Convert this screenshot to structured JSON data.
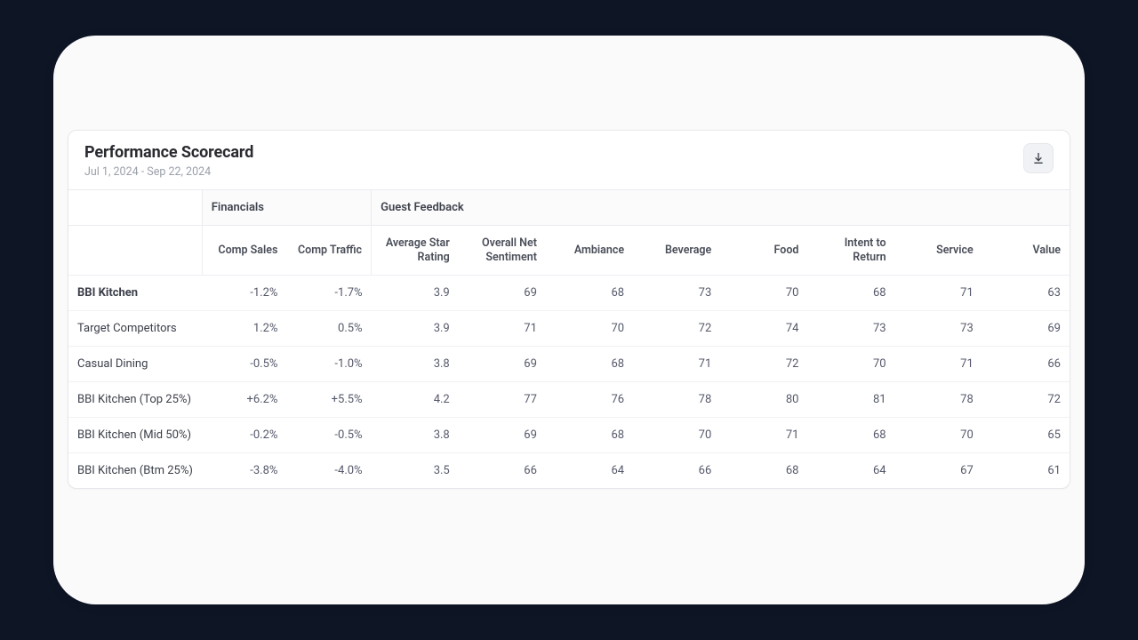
{
  "header": {
    "title": "Performance Scorecard",
    "date_range": "Jul 1, 2024 - Sep 22, 2024"
  },
  "groups": {
    "financials": "Financials",
    "guest_feedback": "Guest Feedback"
  },
  "columns": {
    "comp_sales": "Comp Sales",
    "comp_traffic": "Comp Traffic",
    "avg_star": "Average Star Rating",
    "overall_net": "Overall Net Sentiment",
    "ambiance": "Ambiance",
    "beverage": "Beverage",
    "food": "Food",
    "intent_return": "Intent to Return",
    "service": "Service",
    "value": "Value"
  },
  "rows": [
    {
      "label": "BBI Kitchen",
      "emph": true,
      "comp_sales": "-1.2%",
      "comp_traffic": "-1.7%",
      "avg_star": "3.9",
      "overall_net": "69",
      "ambiance": "68",
      "beverage": "73",
      "food": "70",
      "intent_return": "68",
      "service": "71",
      "value": "63"
    },
    {
      "label": "Target Competitors",
      "emph": false,
      "comp_sales": "1.2%",
      "comp_traffic": "0.5%",
      "avg_star": "3.9",
      "overall_net": "71",
      "ambiance": "70",
      "beverage": "72",
      "food": "74",
      "intent_return": "73",
      "service": "73",
      "value": "69"
    },
    {
      "label": "Casual Dining",
      "emph": false,
      "comp_sales": "-0.5%",
      "comp_traffic": "-1.0%",
      "avg_star": "3.8",
      "overall_net": "69",
      "ambiance": "68",
      "beverage": "71",
      "food": "72",
      "intent_return": "70",
      "service": "71",
      "value": "66"
    },
    {
      "label": "BBI Kitchen (Top 25%)",
      "emph": false,
      "comp_sales": "+6.2%",
      "comp_traffic": "+5.5%",
      "avg_star": "4.2",
      "overall_net": "77",
      "ambiance": "76",
      "beverage": "78",
      "food": "80",
      "intent_return": "81",
      "service": "78",
      "value": "72"
    },
    {
      "label": "BBI Kitchen (Mid 50%)",
      "emph": false,
      "comp_sales": "-0.2%",
      "comp_traffic": "-0.5%",
      "avg_star": "3.8",
      "overall_net": "69",
      "ambiance": "68",
      "beverage": "70",
      "food": "71",
      "intent_return": "68",
      "service": "70",
      "value": "65"
    },
    {
      "label": "BBI Kitchen (Btm 25%)",
      "emph": false,
      "comp_sales": "-3.8%",
      "comp_traffic": "-4.0%",
      "avg_star": "3.5",
      "overall_net": "66",
      "ambiance": "64",
      "beverage": "66",
      "food": "68",
      "intent_return": "64",
      "service": "67",
      "value": "61"
    }
  ]
}
